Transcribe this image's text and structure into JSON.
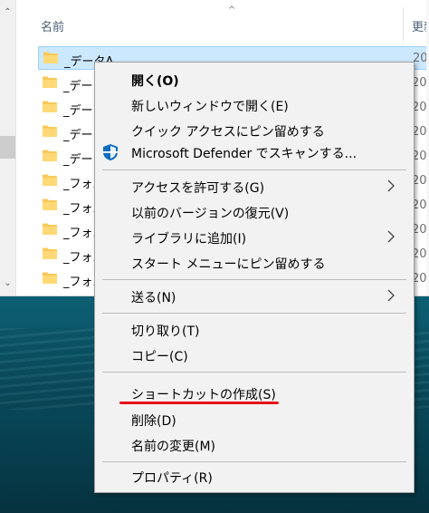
{
  "explorer": {
    "column_name": "名前",
    "column_date": "更新",
    "rows": [
      {
        "name": "_データA",
        "date": "20"
      },
      {
        "name": "_データ",
        "date": "20"
      },
      {
        "name": "_データ",
        "date": "20"
      },
      {
        "name": "_データ",
        "date": "20"
      },
      {
        "name": "_データ",
        "date": "20"
      },
      {
        "name": "_フォル",
        "date": "20"
      },
      {
        "name": "_フォル",
        "date": "20"
      },
      {
        "name": "_フォル",
        "date": "20"
      },
      {
        "name": "_フォル",
        "date": "20"
      },
      {
        "name": "_フォル",
        "date": "20"
      }
    ]
  },
  "context_menu": {
    "open": "開く(O)",
    "open_new_window": "新しいウィンドウで開く(E)",
    "pin_quick_access": "クイック アクセスにピン留めする",
    "defender_scan": "Microsoft Defender でスキャンする...",
    "give_access": "アクセスを許可する(G)",
    "restore_previous": "以前のバージョンの復元(V)",
    "add_to_library": "ライブラリに追加(I)",
    "pin_start": "スタート メニューにピン留めする",
    "send_to": "送る(N)",
    "cut": "切り取り(T)",
    "copy": "コピー(C)",
    "create_shortcut": "ショートカットの作成(S)",
    "delete": "削除(D)",
    "rename": "名前の変更(M)",
    "properties": "プロパティ(R)"
  },
  "colors": {
    "selection": "#cce8ff",
    "highlight_underline": "#e8131a",
    "desktop": "#0a4f61"
  }
}
